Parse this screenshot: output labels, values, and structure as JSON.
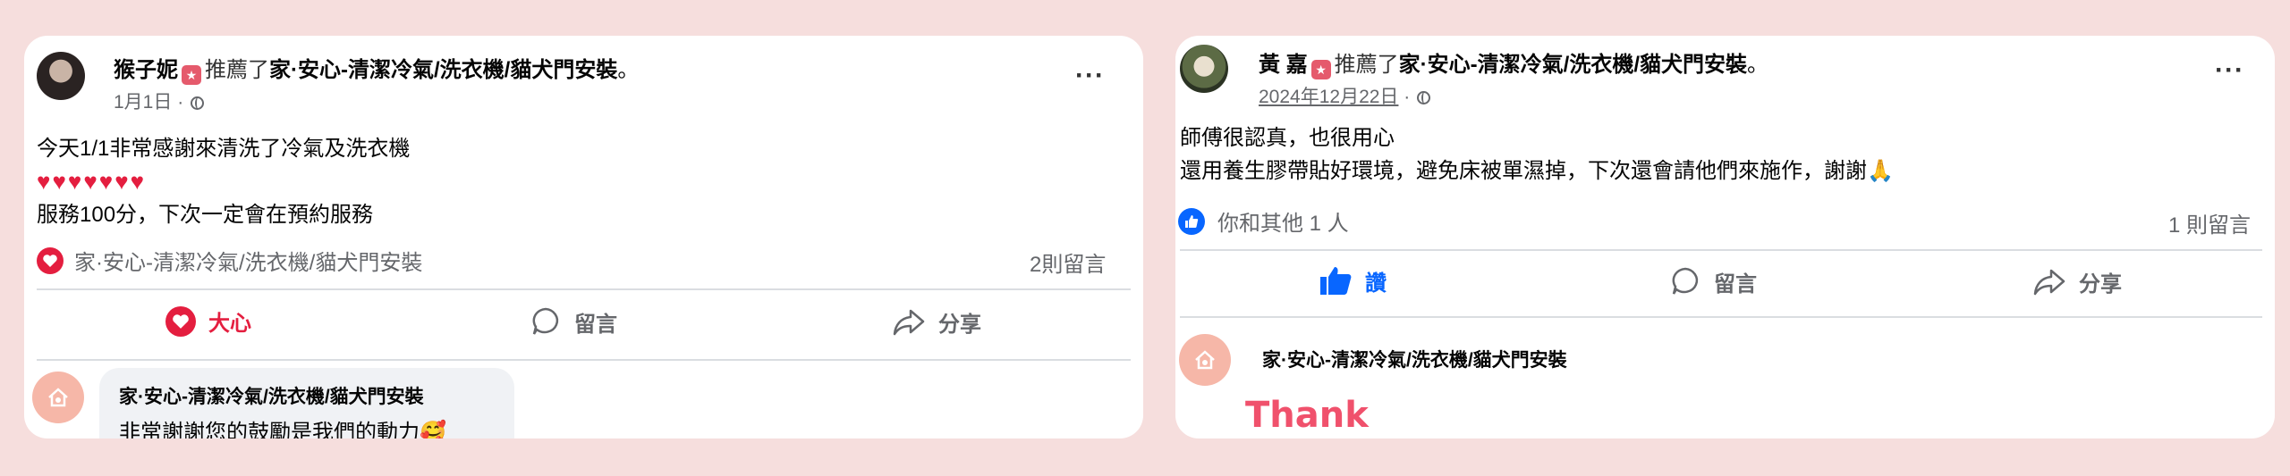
{
  "posts": [
    {
      "author": "猴子妮",
      "verb": "推薦了",
      "page": "家·安心-清潔冷氣/洗衣機/貓犬門安裝",
      "period": "。",
      "date": "1月1日",
      "dot": "·",
      "lines": [
        "今天1/1非常感謝來清洗了冷氣及洗衣機",
        "♥♥♥♥♥♥♥",
        "服務100分，下次一定會在預約服務"
      ],
      "page_tag": "家·安心-清潔冷氣/洗衣機/貓犬門安裝",
      "comments_count": "2則留言",
      "actions": [
        "大心",
        "留言",
        "分享"
      ],
      "comment": {
        "name": "家·安心-清潔冷氣/洗衣機/貓犬門安裝",
        "text": "非常謝謝您的鼓勵是我們的動力🥰"
      }
    },
    {
      "author": "黃 嘉",
      "verb": "推薦了",
      "page": "家·安心-清潔冷氣/洗衣機/貓犬門安裝",
      "period": "。",
      "date": "2024年12月22日",
      "dot": "·",
      "lines": [
        "師傅很認真，也很用心",
        "還用養生膠帶貼好環境，避免床被單濕掉，下次還會請他們來施作，謝謝🙏"
      ],
      "reactions": "你和其他 1 人",
      "comments_count": "1 則留言",
      "actions": [
        "讚",
        "留言",
        "分享"
      ],
      "comment": {
        "name": "家·安心-清潔冷氣/洗衣機/貓犬門安裝",
        "sticker_text": "Thank"
      }
    }
  ],
  "colors": {
    "heart": "#e41e3f",
    "like": "#0866ff",
    "background": "#f6dedd"
  }
}
